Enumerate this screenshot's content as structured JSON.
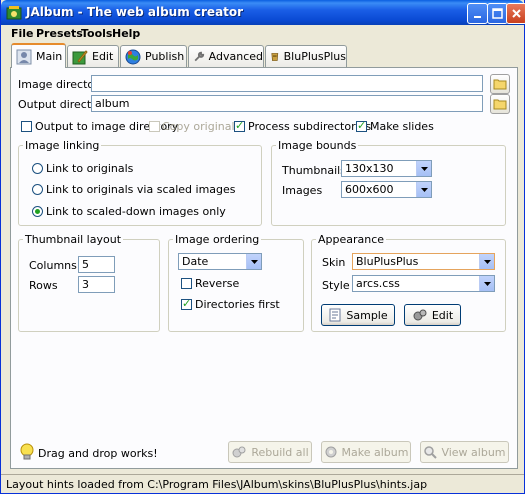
{
  "window": {
    "title": "JAlbum - The web album creator",
    "accent_color": "#0a4ad4"
  },
  "menu": [
    "File",
    "Presets",
    "Tools",
    "Help"
  ],
  "tabs": [
    {
      "label": "Main",
      "icon": "user-icon",
      "active": true
    },
    {
      "label": "Edit",
      "icon": "edit-icon",
      "active": false
    },
    {
      "label": "Publish",
      "icon": "globe-icon",
      "active": false
    },
    {
      "label": "Advanced",
      "icon": "wrench-icon",
      "active": false
    },
    {
      "label": "BluPlusPlus",
      "icon": "skin-icon",
      "active": false
    }
  ],
  "directories": {
    "image_label": "Image directory",
    "image_value": "",
    "output_label": "Output directory",
    "output_value": "album"
  },
  "options": {
    "output_to_image_dir": "Output to image directory",
    "copy_originals": "Copy originals",
    "process_subdirs": "Process subdirectories",
    "make_slides": "Make slides"
  },
  "image_linking": {
    "title": "Image linking",
    "opt1": "Link to originals",
    "opt2": "Link to originals via scaled images",
    "opt3": "Link to scaled-down images only",
    "selected": 3
  },
  "image_bounds": {
    "title": "Image bounds",
    "thumbnails_label": "Thumbnails",
    "thumbnails_value": "130x130",
    "images_label": "Images",
    "images_value": "600x600"
  },
  "thumbnail_layout": {
    "title": "Thumbnail layout",
    "columns_label": "Columns",
    "columns_value": "5",
    "rows_label": "Rows",
    "rows_value": "3"
  },
  "image_ordering": {
    "title": "Image ordering",
    "order_value": "Date",
    "reverse_label": "Reverse",
    "dirs_first_label": "Directories first"
  },
  "appearance": {
    "title": "Appearance",
    "skin_label": "Skin",
    "skin_value": "BluPlusPlus",
    "style_label": "Style",
    "style_value": "arcs.css",
    "sample_label": "Sample",
    "edit_label": "Edit"
  },
  "footer": {
    "hint": "Drag and drop works!",
    "rebuild_label": "Rebuild all",
    "make_album_label": "Make album",
    "view_album_label": "View album"
  },
  "status": "Layout hints loaded from C:\\Program Files\\JAlbum\\skins\\BluPlusPlus\\hints.jap"
}
